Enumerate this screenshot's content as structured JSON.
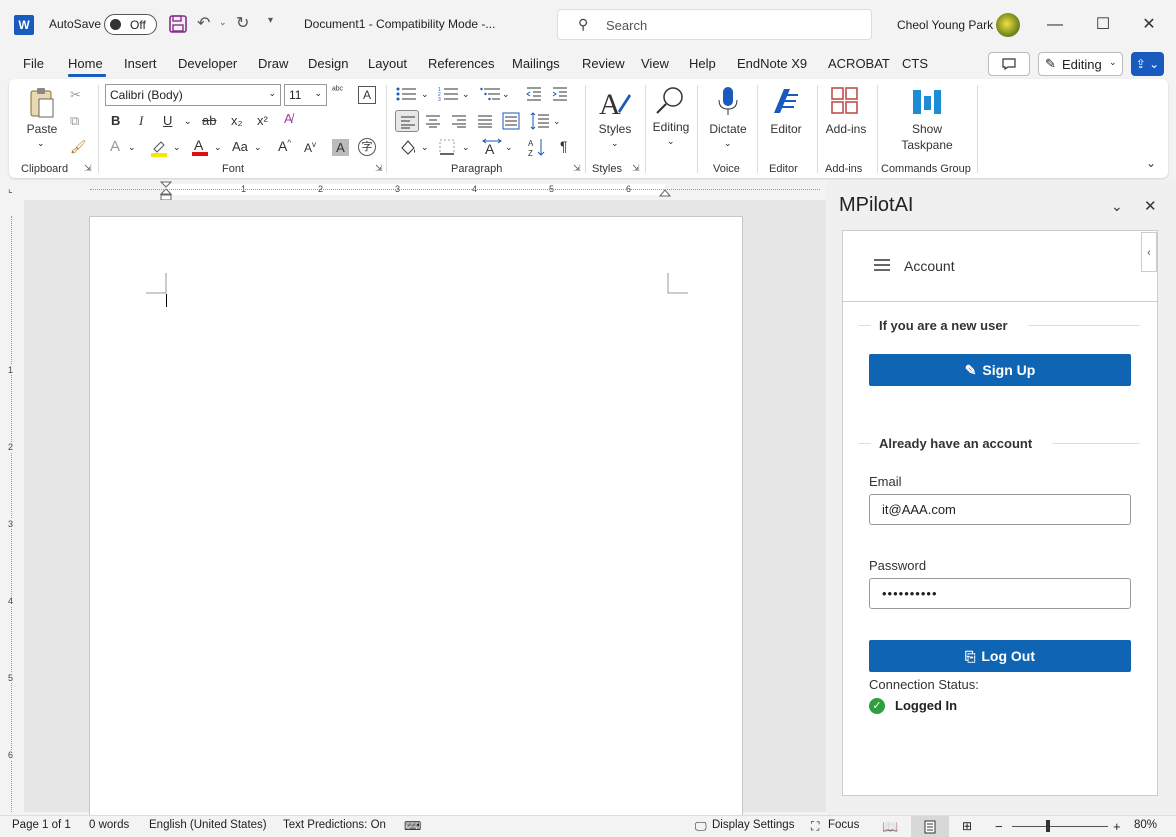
{
  "titlebar": {
    "app_logo": "W",
    "autosave_label": "AutoSave",
    "autosave_state": "Off",
    "document_title": "Document1  -  Compatibility Mode  -...",
    "search_placeholder": "Search",
    "user_name": "Cheol Young Park"
  },
  "menu": {
    "items": [
      "File",
      "Home",
      "Insert",
      "Developer",
      "Draw",
      "Design",
      "Layout",
      "References",
      "Mailings",
      "Review",
      "View",
      "Help",
      "EndNote X9",
      "ACROBAT",
      "CTS"
    ],
    "active": "Home",
    "editing_mode": "Editing"
  },
  "ribbon": {
    "clipboard": {
      "paste_label": "Paste",
      "group_label": "Clipboard"
    },
    "font": {
      "font_name": "Calibri (Body)",
      "font_size": "11",
      "group_label": "Font",
      "bold": "B",
      "italic": "I",
      "underline": "U",
      "strike": "ab",
      "subscript": "x₂",
      "superscript": "x²",
      "change_case": "Aa"
    },
    "paragraph": {
      "group_label": "Paragraph"
    },
    "styles": {
      "label": "Styles",
      "group_label": "Styles"
    },
    "editing": {
      "label": "Editing"
    },
    "voice": {
      "label": "Dictate",
      "group_label": "Voice"
    },
    "editor": {
      "label": "Editor",
      "group_label": "Editor"
    },
    "addins": {
      "label": "Add-ins",
      "group_label": "Add-ins"
    },
    "commands": {
      "label_line1": "Show",
      "label_line2": "Taskpane",
      "group_label": "Commands Group"
    }
  },
  "ruler": {
    "numbers": [
      "1",
      "2",
      "3",
      "4",
      "5",
      "6"
    ],
    "vertical_numbers": [
      "1",
      "2",
      "3",
      "4",
      "5",
      "6"
    ]
  },
  "pane": {
    "title": "MPilotAI",
    "header": "Account",
    "new_user_section": "If you are a new user",
    "signup_button": "Sign Up",
    "existing_section": "Already have an account",
    "email_label": "Email",
    "email_value": "it@AAA.com",
    "password_label": "Password",
    "password_value": "••••••••••",
    "logout_button": "Log Out",
    "connection_label": "Connection Status:",
    "connection_value": "Logged In",
    "status_color": "#2e9e3e"
  },
  "status": {
    "page": "Page 1 of 1",
    "words": "0 words",
    "language": "English (United States)",
    "predictions": "Text Predictions: On",
    "display_settings": "Display Settings",
    "focus": "Focus",
    "zoom": "80%"
  },
  "colors": {
    "accent": "#185abd",
    "pane_button": "#0f64b4"
  }
}
